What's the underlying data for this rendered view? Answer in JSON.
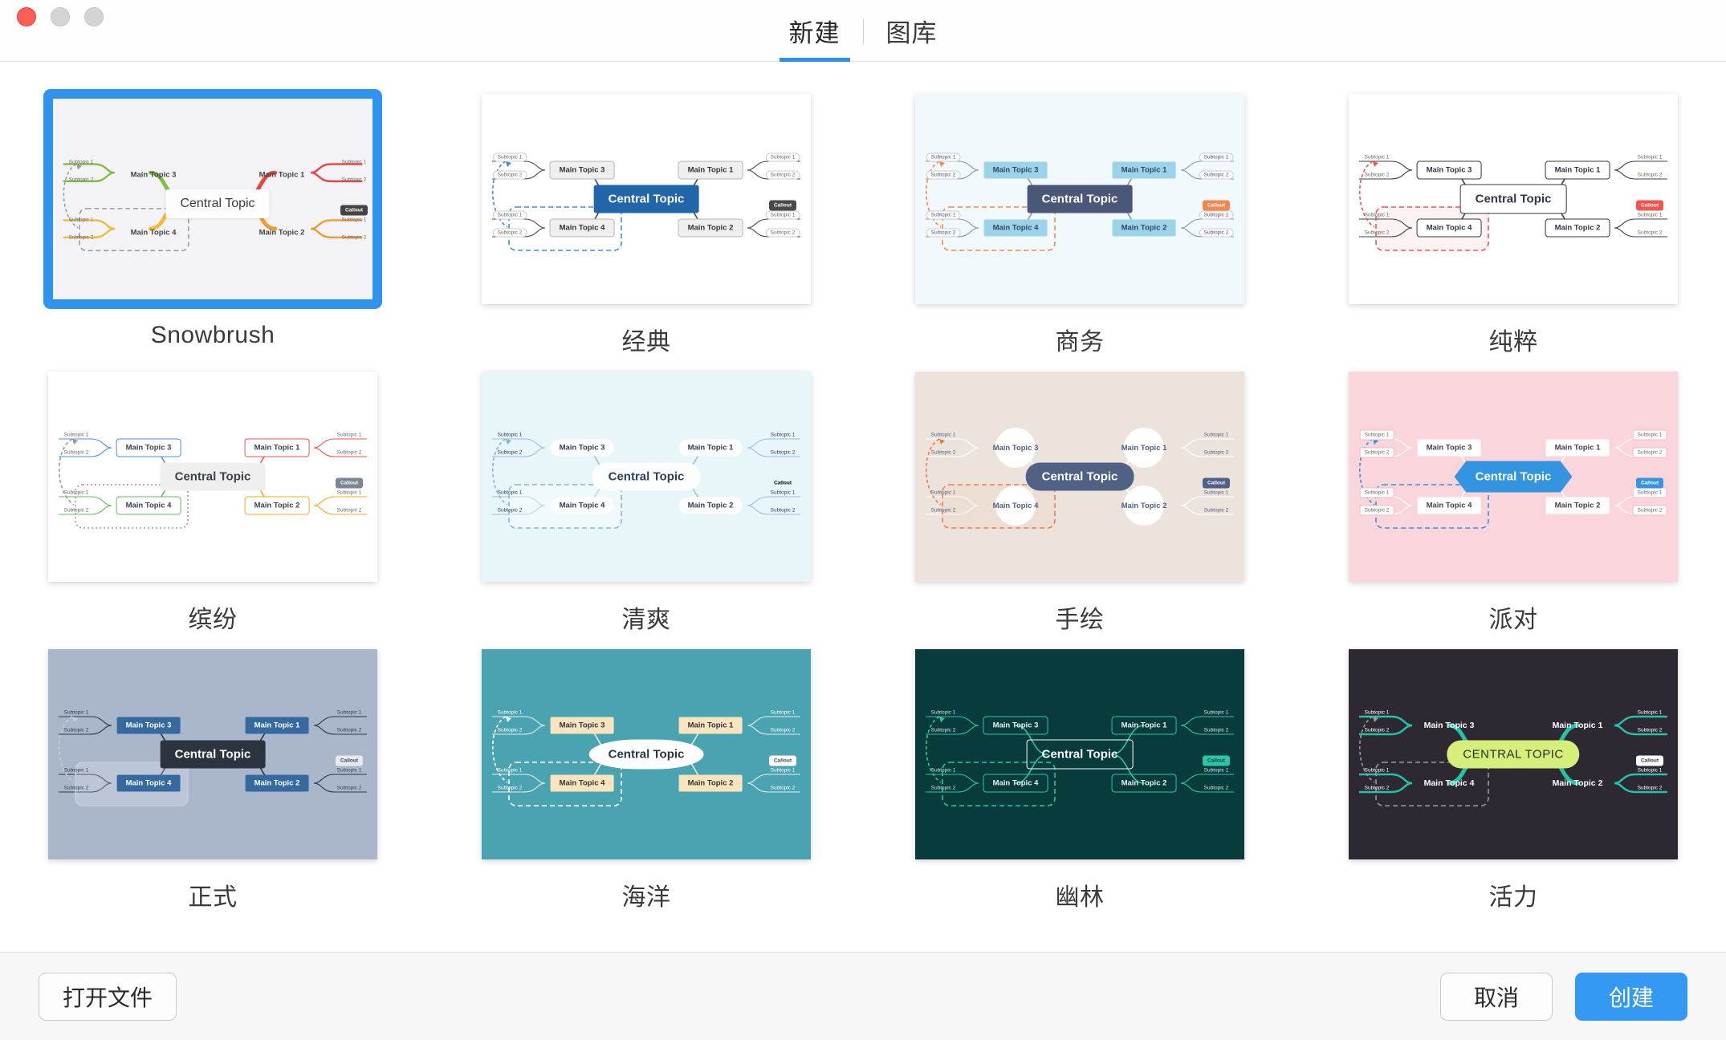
{
  "window": {
    "traffic_lights": [
      "close",
      "minimize",
      "maximize"
    ]
  },
  "header": {
    "tabs": [
      {
        "label": "新建",
        "active": true
      },
      {
        "label": "图库",
        "active": false
      }
    ]
  },
  "accent_color": "#2f93f0",
  "templates": [
    {
      "id": "snowbrush",
      "label": "Snowbrush",
      "selected": true,
      "background": "#f4f3f8",
      "central": {
        "text": "Central Topic",
        "bg": "#fdfdfd",
        "fg": "#3a3a3a",
        "shape": "rect"
      },
      "callout": {
        "text": "Callout",
        "bg": "#444444",
        "fg": "#ffffff"
      },
      "branch_colors": [
        "#e8453c",
        "#f09b2e",
        "#7cc143",
        "#f2b93b"
      ],
      "mains": [
        {
          "text": "Main Topic 1",
          "fg": "#444444",
          "bg": "transparent"
        },
        {
          "text": "Main Topic 2",
          "fg": "#444444",
          "bg": "transparent"
        },
        {
          "text": "Main Topic 3",
          "fg": "#444444",
          "bg": "transparent"
        },
        {
          "text": "Main Topic 4",
          "fg": "#444444",
          "bg": "transparent"
        }
      ],
      "subtopics": [
        "Subtopic 1",
        "Subtopic 2"
      ],
      "boundary": {
        "color": "#9a9a9a",
        "style": "dashed"
      }
    },
    {
      "id": "classic",
      "label": "经典",
      "selected": false,
      "background": "#ffffff",
      "central": {
        "text": "Central Topic",
        "bg": "#2166a8",
        "fg": "#ffffff",
        "shape": "rect"
      },
      "callout": {
        "text": "Callout",
        "bg": "#4a4a4a",
        "fg": "#ffffff"
      },
      "branch_colors": [
        "#4a4a4a",
        "#4a4a4a",
        "#4a4a4a",
        "#4a4a4a"
      ],
      "mains": [
        {
          "text": "Main Topic 1",
          "fg": "#333333",
          "bg": "#efefef"
        },
        {
          "text": "Main Topic 2",
          "fg": "#333333",
          "bg": "#efefef"
        },
        {
          "text": "Main Topic 3",
          "fg": "#333333",
          "bg": "#efefef"
        },
        {
          "text": "Main Topic 4",
          "fg": "#333333",
          "bg": "#efefef"
        }
      ],
      "subtopics": [
        "Subtopic 1",
        "Subtopic 2"
      ],
      "boundary": {
        "color": "#3e8ede",
        "style": "dashed"
      }
    },
    {
      "id": "business",
      "label": "商务",
      "selected": false,
      "background": "#f1f9fd",
      "central": {
        "text": "Central Topic",
        "bg": "#4a5878",
        "fg": "#ffffff",
        "shape": "rect"
      },
      "callout": {
        "text": "Callout",
        "bg": "#f2884b",
        "fg": "#ffffff"
      },
      "branch_colors": [
        "#8b97a8",
        "#8b97a8",
        "#8b97a8",
        "#8b97a8"
      ],
      "mains": [
        {
          "text": "Main Topic 1",
          "fg": "#37455f",
          "bg": "#9bd4e8"
        },
        {
          "text": "Main Topic 2",
          "fg": "#37455f",
          "bg": "#9bd4e8"
        },
        {
          "text": "Main Topic 3",
          "fg": "#37455f",
          "bg": "#9bd4e8"
        },
        {
          "text": "Main Topic 4",
          "fg": "#37455f",
          "bg": "#9bd4e8"
        }
      ],
      "subtopics": [
        "Subtopic 1",
        "Subtopic 2"
      ],
      "boundary": {
        "color": "#f2884b",
        "style": "dashed"
      }
    },
    {
      "id": "pure",
      "label": "纯粹",
      "selected": false,
      "background": "#ffffff",
      "central": {
        "text": "Central Topic",
        "bg": "#ffffff",
        "fg": "#2f3845",
        "shape": "rect-outline"
      },
      "callout": {
        "text": "Callout",
        "bg": "#f4544f",
        "fg": "#ffffff"
      },
      "branch_colors": [
        "#33404f",
        "#33404f",
        "#33404f",
        "#33404f"
      ],
      "mains": [
        {
          "text": "Main Topic 1",
          "fg": "#2f3845",
          "bg": "#ffffff"
        },
        {
          "text": "Main Topic 2",
          "fg": "#2f3845",
          "bg": "#ffffff"
        },
        {
          "text": "Main Topic 3",
          "fg": "#2f3845",
          "bg": "#ffffff"
        },
        {
          "text": "Main Topic 4",
          "fg": "#2f3845",
          "bg": "#ffffff"
        }
      ],
      "subtopics": [
        "Subtopic 1",
        "Subtopic 2"
      ],
      "boundary": {
        "color": "#f4544f",
        "style": "dashed"
      }
    },
    {
      "id": "colorful",
      "label": "缤纷",
      "selected": false,
      "background": "#ffffff",
      "central": {
        "text": "Central Topic",
        "bg": "#efefef",
        "fg": "#3b4250",
        "shape": "rect"
      },
      "callout": {
        "text": "Callout",
        "bg": "#7b8694",
        "fg": "#ffffff"
      },
      "branch_colors": [
        "#ef5350",
        "#f5a623",
        "#4a90e2",
        "#63ba5c"
      ],
      "mains": [
        {
          "text": "Main Topic 1",
          "fg": "#3b4250",
          "bg": "#ffffff"
        },
        {
          "text": "Main Topic 2",
          "fg": "#3b4250",
          "bg": "#ffffff"
        },
        {
          "text": "Main Topic 3",
          "fg": "#3b4250",
          "bg": "#ffffff"
        },
        {
          "text": "Main Topic 4",
          "fg": "#3b4250",
          "bg": "#ffffff"
        }
      ],
      "subtopics": [
        "Subtopic 1",
        "Subtopic 2"
      ],
      "boundary": {
        "color": "#9a9a9a",
        "style": "dotted"
      }
    },
    {
      "id": "fresh",
      "label": "清爽",
      "selected": false,
      "background": "#e8f6fa",
      "central": {
        "text": "Central Topic",
        "bg": "#fdfdfd",
        "fg": "#2e4258",
        "shape": "pill"
      },
      "callout": {
        "text": "Callout",
        "bg": "transparent",
        "fg": "#5b7punct"
      },
      "branch_colors": [
        "#9fc0d4",
        "#9fc0d4",
        "#9fc0d4",
        "#9fc0d4"
      ],
      "mains": [
        {
          "text": "Main Topic 1",
          "fg": "#2e4258",
          "bg": "#fdfdfd"
        },
        {
          "text": "Main Topic 2",
          "fg": "#2e4258",
          "bg": "#fdfdfd"
        },
        {
          "text": "Main Topic 3",
          "fg": "#2e4258",
          "bg": "#fdfdfd"
        },
        {
          "text": "Main Topic 4",
          "fg": "#2e4258",
          "bg": "#fdfdfd"
        }
      ],
      "subtopics": [
        "Subtopic 1",
        "Subtopic 2"
      ],
      "boundary": {
        "color": "#83b8d4",
        "style": "dashed"
      }
    },
    {
      "id": "handdrawn",
      "label": "手绘",
      "selected": false,
      "background": "#ece4dc",
      "central": {
        "text": "Central Topic",
        "bg": "#4f6185",
        "fg": "#ffffff",
        "shape": "pill"
      },
      "callout": {
        "text": "Callout",
        "bg": "#4f6185",
        "fg": "#ffffff"
      },
      "branch_colors": [
        "#ffffff",
        "#ffffff",
        "#ffffff",
        "#ffffff"
      ],
      "mains": [
        {
          "text": "Main Topic 1",
          "fg": "#4f6185",
          "bg": "#ffffff"
        },
        {
          "text": "Main Topic 2",
          "fg": "#4f6185",
          "bg": "#ffffff"
        },
        {
          "text": "Main Topic 3",
          "fg": "#4f6185",
          "bg": "#ffffff"
        },
        {
          "text": "Main Topic 4",
          "fg": "#4f6185",
          "bg": "#ffffff"
        }
      ],
      "subtopics": [
        "Subtopic 1",
        "Subtopic 2"
      ],
      "boundary": {
        "color": "#ef7e44",
        "style": "dashed"
      }
    },
    {
      "id": "party",
      "label": "派对",
      "selected": false,
      "background": "#fbd5dc",
      "central": {
        "text": "Central Topic",
        "bg": "#3394e0",
        "fg": "#ffffff",
        "shape": "hexagon"
      },
      "callout": {
        "text": "Callout",
        "bg": "#3394e0",
        "fg": "#ffffff"
      },
      "branch_colors": [
        "#ffffff",
        "#ffffff",
        "#ffffff",
        "#ffffff"
      ],
      "mains": [
        {
          "text": "Main Topic 1",
          "fg": "#444444",
          "bg": "#ffffff"
        },
        {
          "text": "Main Topic 2",
          "fg": "#444444",
          "bg": "#ffffff"
        },
        {
          "text": "Main Topic 3",
          "fg": "#444444",
          "bg": "#ffffff"
        },
        {
          "text": "Main Topic 4",
          "fg": "#444444",
          "bg": "#ffffff"
        }
      ],
      "subtopics": [
        "Subtopic 1",
        "Subtopic 2"
      ],
      "boundary": {
        "color": "#3394e0",
        "style": "dashed"
      }
    },
    {
      "id": "formal",
      "label": "正式",
      "selected": false,
      "background": "#aab7cb",
      "central": {
        "text": "Central Topic",
        "bg": "#2c3440",
        "fg": "#ffffff",
        "shape": "rect"
      },
      "callout": {
        "text": "Callout",
        "bg": "#e6e9ee",
        "fg": "#3b4454"
      },
      "branch_colors": [
        "#2c3440",
        "#2c3440",
        "#2c3440",
        "#2c3440"
      ],
      "mains": [
        {
          "text": "Main Topic 1",
          "fg": "#ffffff",
          "bg": "#36699f"
        },
        {
          "text": "Main Topic 2",
          "fg": "#ffffff",
          "bg": "#36699f"
        },
        {
          "text": "Main Topic 3",
          "fg": "#ffffff",
          "bg": "#36699f"
        },
        {
          "text": "Main Topic 4",
          "fg": "#ffffff",
          "bg": "#36699f"
        }
      ],
      "subtopics": [
        "Subtopic 1",
        "Subtopic 2"
      ],
      "boundary": {
        "color": "#c4cedd",
        "style": "solid"
      }
    },
    {
      "id": "ocean",
      "label": "海洋",
      "selected": false,
      "background": "#4aa3b0",
      "central": {
        "text": "Central Topic",
        "bg": "#ffffff",
        "fg": "#2c3440",
        "shape": "lens"
      },
      "callout": {
        "text": "Callout",
        "bg": "#ffffff",
        "fg": "#3b4454"
      },
      "branch_colors": [
        "#e9eef0",
        "#e9eef0",
        "#e9eef0",
        "#e9eef0"
      ],
      "mains": [
        {
          "text": "Main Topic 1",
          "fg": "#2c3440",
          "bg": "#fae3bd"
        },
        {
          "text": "Main Topic 2",
          "fg": "#2c3440",
          "bg": "#fae3bd"
        },
        {
          "text": "Main Topic 3",
          "fg": "#2c3440",
          "bg": "#fae3bd"
        },
        {
          "text": "Main Topic 4",
          "fg": "#2c3440",
          "bg": "#fae3bd"
        }
      ],
      "subtopics": [
        "Subtopic 1",
        "Subtopic 2"
      ],
      "boundary": {
        "color": "#ffffff",
        "style": "dashed"
      }
    },
    {
      "id": "deepforest",
      "label": "幽林",
      "selected": false,
      "background": "#073b3c",
      "central": {
        "text": "Central Topic",
        "bg": "transparent",
        "fg": "#ffffff",
        "shape": "rect-outline"
      },
      "callout": {
        "text": "Callout",
        "bg": "#2ec4a6",
        "fg": "#0a3c3c"
      },
      "branch_colors": [
        "#2ec4a6",
        "#2ec4a6",
        "#2ec4a6",
        "#2ec4a6"
      ],
      "mains": [
        {
          "text": "Main Topic 1",
          "fg": "#e8f6f2",
          "bg": "transparent"
        },
        {
          "text": "Main Topic 2",
          "fg": "#e8f6f2",
          "bg": "transparent"
        },
        {
          "text": "Main Topic 3",
          "fg": "#e8f6f2",
          "bg": "transparent"
        },
        {
          "text": "Main Topic 4",
          "fg": "#e8f6f2",
          "bg": "transparent"
        }
      ],
      "subtopics": [
        "Subtopic 1",
        "Subtopic 2"
      ],
      "boundary": {
        "color": "#2ec4a6",
        "style": "dashed"
      }
    },
    {
      "id": "vitality",
      "label": "活力",
      "selected": false,
      "background": "#2e2833",
      "central": {
        "text": "CENTRAL TOPIC",
        "bg": "#d6ef7a",
        "fg": "#2b2b2b",
        "shape": "pill"
      },
      "callout": {
        "text": "Callout",
        "bg": "#ffffff",
        "fg": "#333333"
      },
      "branch_colors": [
        "#22c3a6",
        "#22c3a6",
        "#22c3a6",
        "#22c3a6"
      ],
      "mains": [
        {
          "text": "Main Topic 1",
          "fg": "#ffffff",
          "bg": "transparent"
        },
        {
          "text": "Main Topic 2",
          "fg": "#ffffff",
          "bg": "transparent"
        },
        {
          "text": "Main Topic 3",
          "fg": "#ffffff",
          "bg": "transparent"
        },
        {
          "text": "Main Topic 4",
          "fg": "#ffffff",
          "bg": "transparent"
        }
      ],
      "subtopics": [
        "Subtopic 1",
        "Subtopic 2"
      ],
      "boundary": {
        "color": "#9a9a9a",
        "style": "dashed"
      }
    }
  ],
  "footer": {
    "open_file_label": "打开文件",
    "cancel_label": "取消",
    "create_label": "创建"
  }
}
